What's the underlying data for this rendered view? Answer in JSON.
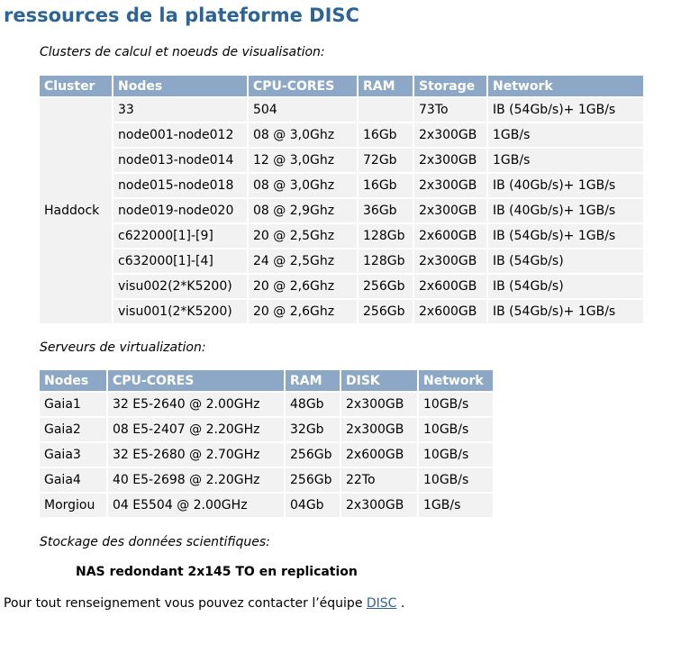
{
  "page": {
    "title": "ressources de la plateforme DISC"
  },
  "clusters": {
    "label": "Clusters de calcul et noeuds de visualisation:",
    "headers": [
      "Cluster",
      "Nodes",
      "CPU-CORES",
      "RAM",
      "Storage",
      "Network"
    ],
    "cluster_name": "Haddock",
    "rows": [
      [
        "33",
        "504",
        "",
        "73To",
        "IB (54Gb/s)+ 1GB/s"
      ],
      [
        "node001-node012",
        "08 @ 3,0Ghz",
        "16Gb",
        "2x300GB",
        "1GB/s"
      ],
      [
        "node013-node014",
        "12 @ 3,0Ghz",
        "72Gb",
        "2x300GB",
        "1GB/s"
      ],
      [
        "node015-node018",
        "08 @ 3,0Ghz",
        "16Gb",
        "2x300GB",
        "IB (40Gb/s)+ 1GB/s"
      ],
      [
        "node019-node020",
        "08 @ 2,9Ghz",
        "36Gb",
        "2x300GB",
        "IB (40Gb/s)+ 1GB/s"
      ],
      [
        "c622000[1]-[9]",
        "20 @ 2,5Ghz",
        "128Gb",
        "2x600GB",
        "IB (54Gb/s)+ 1GB/s"
      ],
      [
        "c632000[1]-[4]",
        "24 @ 2,5Ghz",
        "128Gb",
        "2x300GB",
        "IB (54Gb/s)"
      ],
      [
        "visu002(2*K5200)",
        "20 @ 2,6Ghz",
        "256Gb",
        "2x600GB",
        "IB (54Gb/s)"
      ],
      [
        "visu001(2*K5200)",
        "20 @ 2,6Ghz",
        "256Gb",
        "2x600GB",
        "IB (54Gb/s)+ 1GB/s"
      ]
    ]
  },
  "virtualization": {
    "label": "Serveurs de virtualization:",
    "headers": [
      "Nodes",
      "CPU-CORES",
      "RAM",
      "DISK",
      "Network"
    ],
    "rows": [
      [
        "Gaia1",
        "32 E5-2640 @ 2.00GHz",
        "48Gb",
        "2x300GB",
        "10GB/s"
      ],
      [
        "Gaia2",
        "08 E5-2407 @ 2.20GHz",
        "32Gb",
        "2x300GB",
        "10GB/s"
      ],
      [
        "Gaia3",
        "32 E5-2680 @ 2.70GHz",
        "256Gb",
        "2x600GB",
        "10GB/s"
      ],
      [
        "Gaia4",
        "40 E5-2698 @ 2.20GHz",
        "256Gb",
        "22To",
        "10GB/s"
      ],
      [
        "Morgiou",
        "04 E5504 @ 2.00GHz",
        "04Gb",
        "2x300GB",
        "1GB/s"
      ]
    ]
  },
  "storage": {
    "label": "Stockage des données scientifiques:",
    "nas": "NAS redondant 2x145 TO en replication"
  },
  "contact": {
    "text": "Pour tout renseignement vous pouvez contacter l’équipe ",
    "link": "DISC",
    "suffix": " ."
  }
}
